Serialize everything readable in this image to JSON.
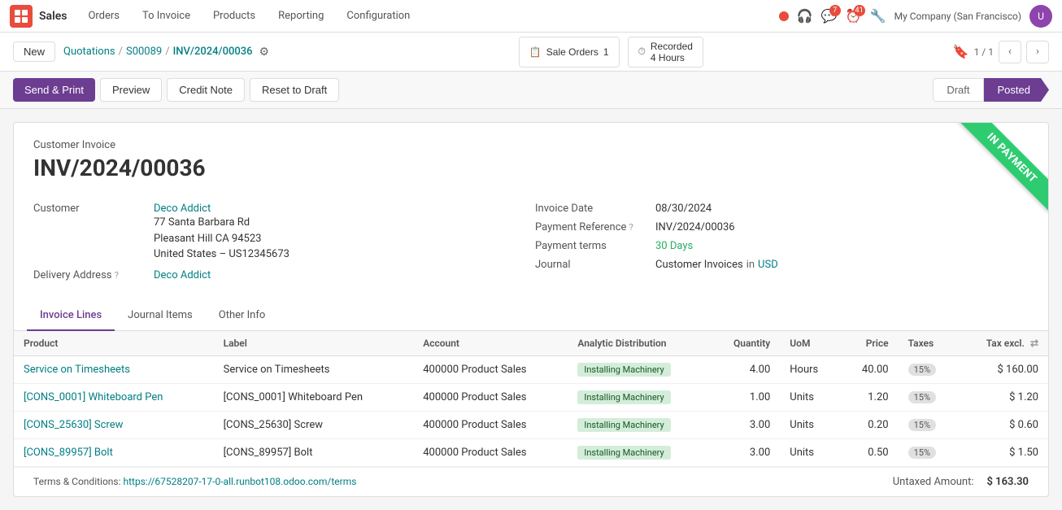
{
  "app": {
    "name": "Sales"
  },
  "nav": {
    "items": [
      {
        "label": "Orders"
      },
      {
        "label": "To Invoice"
      },
      {
        "label": "Products"
      },
      {
        "label": "Reporting"
      },
      {
        "label": "Configuration"
      }
    ]
  },
  "topRight": {
    "company": "My Company (San Francisco)",
    "badges": {
      "messages": "7",
      "activity": "41"
    }
  },
  "breadcrumb": {
    "new_label": "New",
    "parent": "Quotations",
    "separator": "/",
    "child": "S00089",
    "current": "INV/2024/00036",
    "page": "1 / 1"
  },
  "stats": {
    "sale_orders_label": "Sale Orders",
    "sale_orders_value": "1",
    "recorded_label": "Recorded",
    "recorded_value": "4 Hours"
  },
  "actions": {
    "send_print": "Send & Print",
    "preview": "Preview",
    "credit_note": "Credit Note",
    "reset_draft": "Reset to Draft",
    "status_draft": "Draft",
    "status_posted": "Posted"
  },
  "invoice": {
    "type": "Customer Invoice",
    "number": "INV/2024/00036",
    "ribbon": "IN PAYMENT"
  },
  "customer": {
    "label": "Customer",
    "name": "Deco Addict",
    "address_line1": "77 Santa Barbara Rd",
    "address_line2": "Pleasant Hill CA 94523",
    "address_line3": "United States – US12345673",
    "delivery_label": "Delivery Address",
    "delivery_name": "Deco Addict"
  },
  "fields": {
    "invoice_date_label": "Invoice Date",
    "invoice_date_value": "08/30/2024",
    "payment_ref_label": "Payment Reference",
    "payment_ref_help": "?",
    "payment_ref_value": "INV/2024/00036",
    "payment_terms_label": "Payment terms",
    "payment_terms_value": "30 Days",
    "journal_label": "Journal",
    "journal_value": "Customer Invoices",
    "journal_in": "in",
    "journal_currency": "USD"
  },
  "tabs": [
    {
      "label": "Invoice Lines",
      "active": true
    },
    {
      "label": "Journal Items",
      "active": false
    },
    {
      "label": "Other Info",
      "active": false
    }
  ],
  "table": {
    "columns": [
      {
        "key": "product",
        "label": "Product"
      },
      {
        "key": "label",
        "label": "Label"
      },
      {
        "key": "account",
        "label": "Account"
      },
      {
        "key": "analytic",
        "label": "Analytic Distribution"
      },
      {
        "key": "quantity",
        "label": "Quantity"
      },
      {
        "key": "uom",
        "label": "UoM"
      },
      {
        "key": "price",
        "label": "Price"
      },
      {
        "key": "taxes",
        "label": "Taxes"
      },
      {
        "key": "tax_excl",
        "label": "Tax excl."
      }
    ],
    "rows": [
      {
        "product": "Service on Timesheets",
        "label": "Service on Timesheets",
        "account": "400000 Product Sales",
        "analytic": "Installing Machinery",
        "quantity": "4.00",
        "uom": "Hours",
        "price": "40.00",
        "taxes": "15%",
        "tax_excl": "$ 160.00"
      },
      {
        "product": "[CONS_0001] Whiteboard Pen",
        "label": "[CONS_0001] Whiteboard Pen",
        "account": "400000 Product Sales",
        "analytic": "Installing Machinery",
        "quantity": "1.00",
        "uom": "Units",
        "price": "1.20",
        "taxes": "15%",
        "tax_excl": "$ 1.20"
      },
      {
        "product": "[CONS_25630] Screw",
        "label": "[CONS_25630] Screw",
        "account": "400000 Product Sales",
        "analytic": "Installing Machinery",
        "quantity": "3.00",
        "uom": "Units",
        "price": "0.20",
        "taxes": "15%",
        "tax_excl": "$ 0.60"
      },
      {
        "product": "[CONS_89957] Bolt",
        "label": "[CONS_89957] Bolt",
        "account": "400000 Product Sales",
        "analytic": "Installing Machinery",
        "quantity": "3.00",
        "uom": "Units",
        "price": "0.50",
        "taxes": "15%",
        "tax_excl": "$ 1.50"
      }
    ]
  },
  "footer": {
    "terms_label": "Terms & Conditions:",
    "terms_link": "https://67528207-17-0-all.runbot108.odoo.com/terms",
    "untaxed_label": "Untaxed Amount:",
    "untaxed_value": "$ 163.30"
  }
}
